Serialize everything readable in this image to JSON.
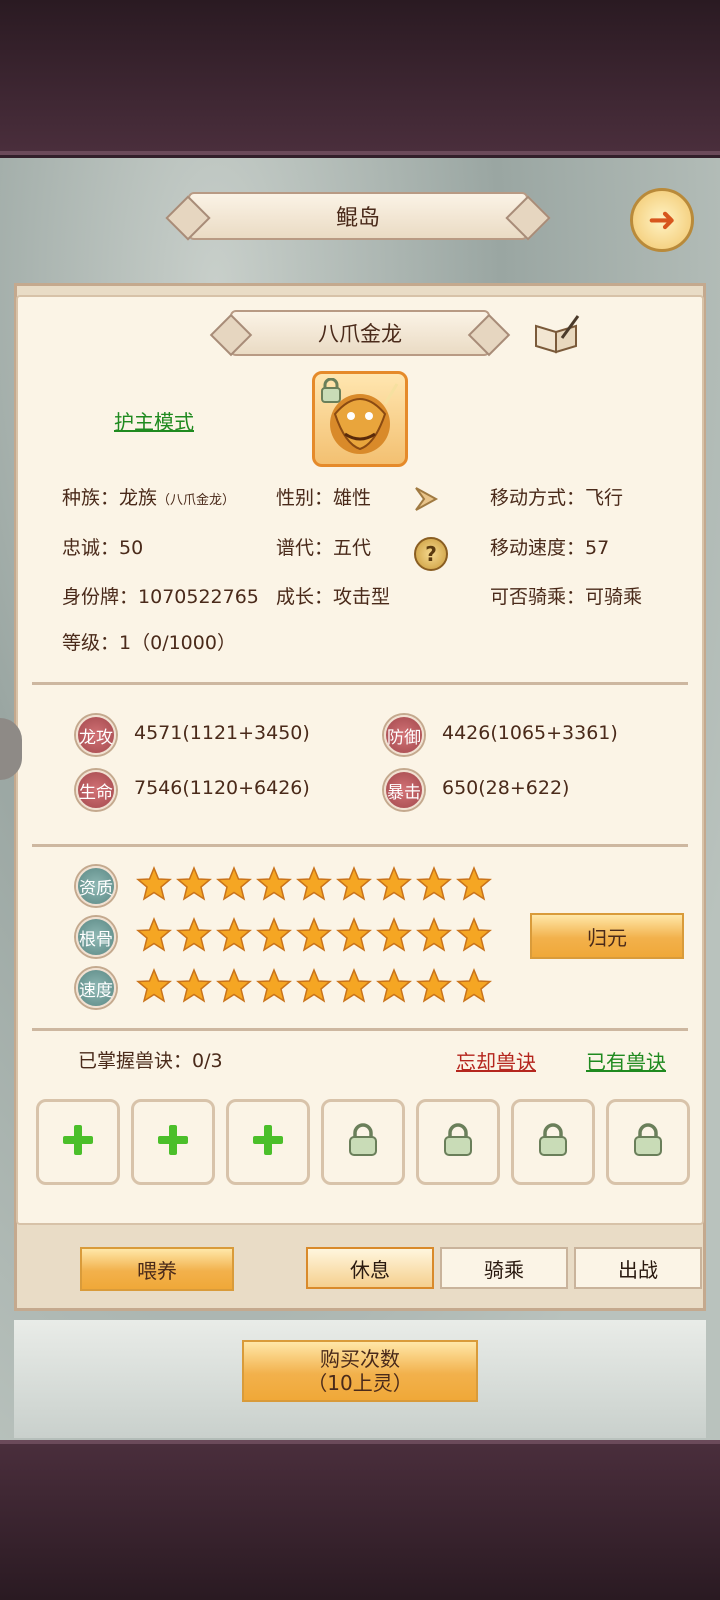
{
  "header": {
    "title": "鲲岛"
  },
  "pet": {
    "name": "八爪金龙",
    "mode_link": "护主模式",
    "info": {
      "race_label": "种族：",
      "race_value": "龙族",
      "race_sub": "（八爪金龙）",
      "gender_label": "性别：",
      "gender_value": "雄性",
      "move_type_label": "移动方式：",
      "move_type_value": "飞行",
      "loyalty_label": "忠诚：",
      "loyalty_value": "50",
      "generation_label": "谱代：",
      "generation_value": "五代",
      "move_speed_label": "移动速度：",
      "move_speed_value": "57",
      "id_label": "身份牌：",
      "id_value": "1070522765",
      "growth_label": "成长：",
      "growth_value": "攻击型",
      "rideable_label": "可否骑乘：",
      "rideable_value": "可骑乘",
      "level_label": "等级：",
      "level_value": "1（0/1000）"
    },
    "help_icon": "?"
  },
  "stats": {
    "attack": {
      "badge": "龙攻",
      "value": "4571(1121+3450)"
    },
    "defense": {
      "badge": "防御",
      "value": "4426(1065+3361)"
    },
    "hp": {
      "badge": "生命",
      "value": "7546(1120+6426)"
    },
    "crit": {
      "badge": "暴击",
      "value": "650(28+622)"
    }
  },
  "aptitudes": [
    {
      "label": "资质",
      "stars": 9
    },
    {
      "label": "根骨",
      "stars": 9
    },
    {
      "label": "速度",
      "stars": 9
    }
  ],
  "reset_button": "归元",
  "skills": {
    "mastered_label": "已掌握兽诀：",
    "mastered_value": "0/3",
    "forget_link": "忘却兽诀",
    "owned_link": "已有兽诀",
    "slots": [
      "add",
      "add",
      "add",
      "locked",
      "locked",
      "locked",
      "locked"
    ]
  },
  "actions": {
    "feed": "喂养",
    "rest": "休息",
    "ride": "骑乘",
    "battle": "出战"
  },
  "buy": {
    "line1": "购买次数",
    "line2": "（10上灵）"
  },
  "colors": {
    "accent_gold": "#f2b14c",
    "link_green": "#1f8a1f",
    "link_red": "#b5261e",
    "stat_badge": "#a2484c"
  }
}
